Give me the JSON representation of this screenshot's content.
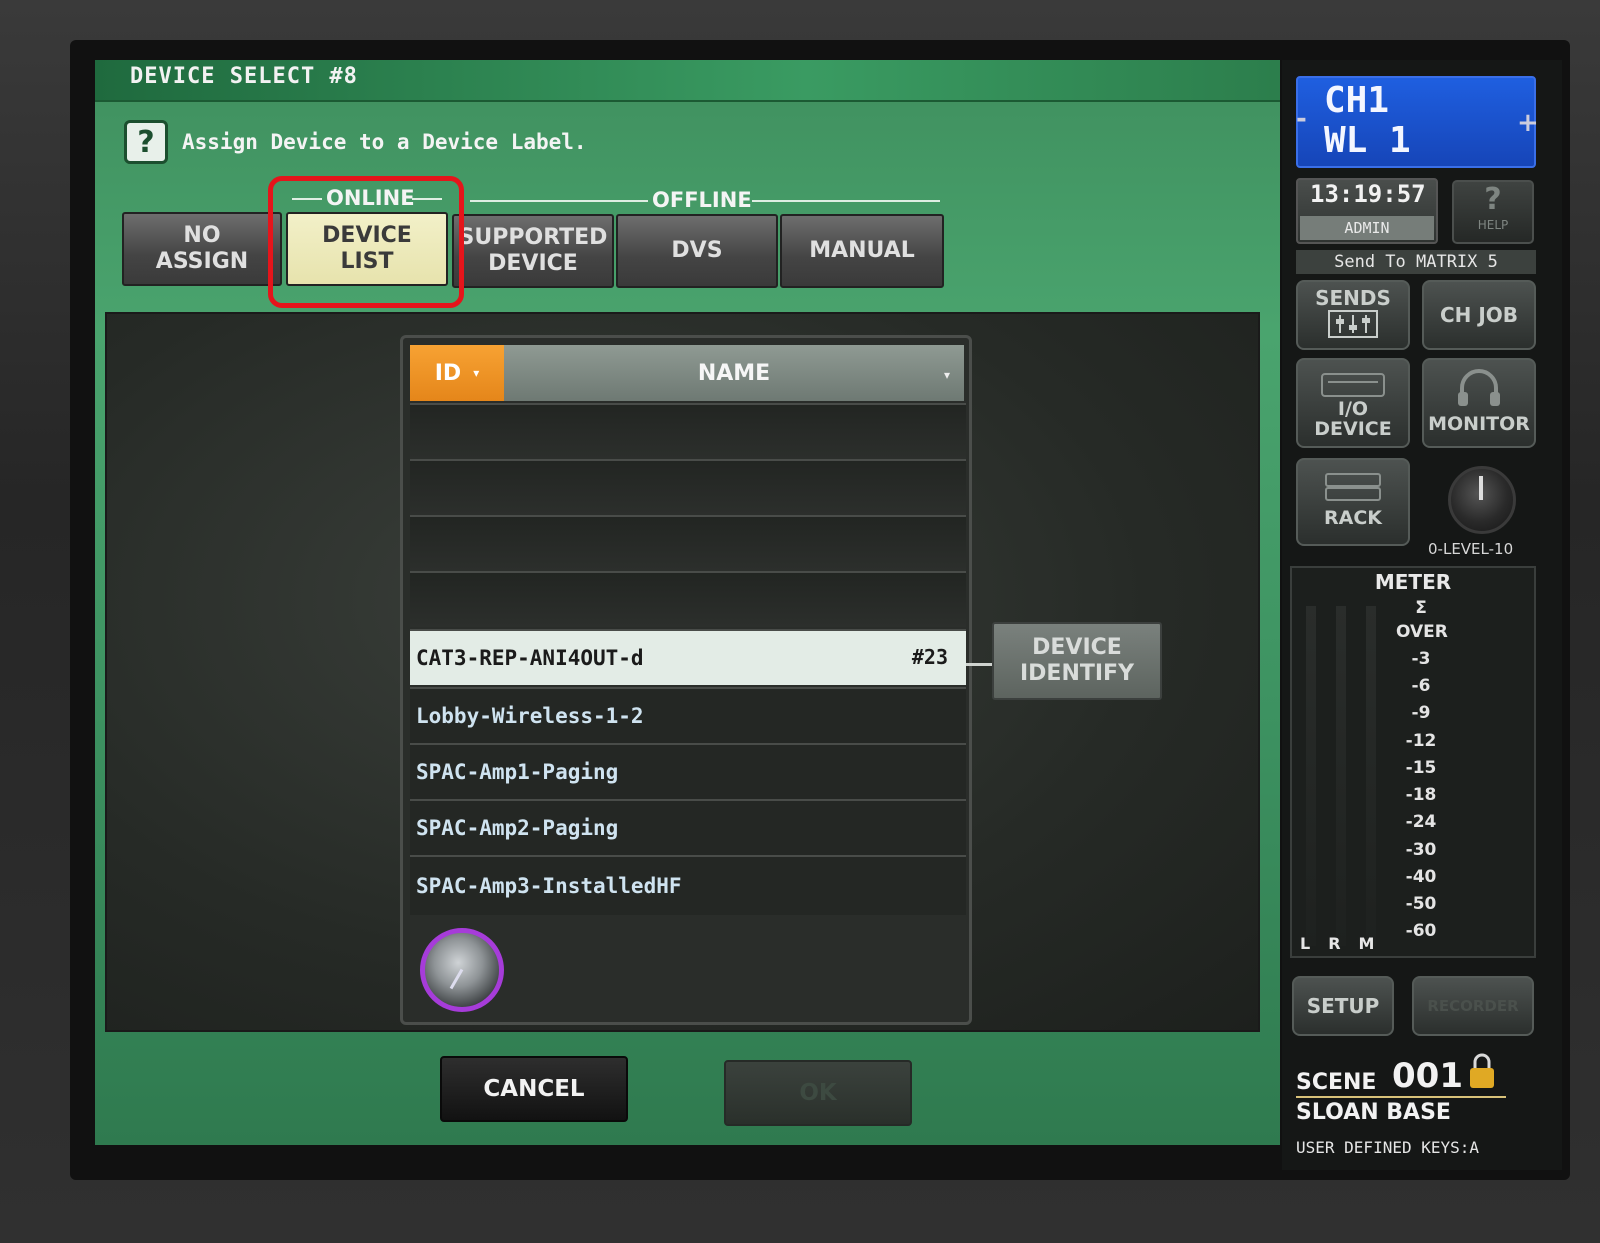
{
  "dialog": {
    "title": "DEVICE SELECT #8",
    "instruction": "Assign Device to a Device Label.",
    "help_glyph": "?",
    "groups": {
      "online": "ONLINE",
      "offline": "OFFLINE"
    },
    "tabs": [
      {
        "label": "NO\nASSIGN",
        "active": false
      },
      {
        "label": "DEVICE\nLIST",
        "active": true
      },
      {
        "label": "SUPPORTED\nDEVICE",
        "active": false
      },
      {
        "label": "DVS",
        "active": false
      },
      {
        "label": "MANUAL",
        "active": false
      }
    ],
    "list": {
      "col_id": "ID",
      "col_name": "NAME",
      "sort_arrow": "▾",
      "rows": [
        {
          "name": "CAT3-REP-ANI4OUT-d",
          "id": "#23"
        },
        {
          "name": "Lobby-Wireless-1-2",
          "id": ""
        },
        {
          "name": "SPAC-Amp1-Paging",
          "id": ""
        },
        {
          "name": "SPAC-Amp2-Paging",
          "id": ""
        },
        {
          "name": "SPAC-Amp3-InstalledHF",
          "id": ""
        }
      ]
    },
    "identify_button": "DEVICE\nIDENTIFY",
    "cancel_button": "CANCEL",
    "ok_button": "OK"
  },
  "sidebar": {
    "channel_line1": "CH1",
    "channel_line2": "WL 1",
    "minus": "-",
    "plus": "+",
    "time": "13:19:57",
    "user": "ADMIN",
    "help_glyph": "?",
    "help_label": "HELP",
    "send_to": "Send To MATRIX 5",
    "sends_label": "SENDS",
    "ch_job_label": "CH JOB",
    "io_device_label": "I/O\nDEVICE",
    "monitor_label": "MONITOR",
    "rack_label": "RACK",
    "level_label": "0-LEVEL-10",
    "meter_title": "METER",
    "meter_scale": [
      "Σ",
      "OVER",
      "-3",
      "-6",
      "-9",
      "-12",
      "-15",
      "-18",
      "-24",
      "-30",
      "-40",
      "-50",
      "-60"
    ],
    "meter_channels": "LRM",
    "setup_label": "SETUP",
    "recorder_label": "RECORDER",
    "scene_label": "SCENE",
    "scene_number": "001",
    "scene_name": "SLOAN BASE",
    "user_keys": "USER DEFINED KEYS:A"
  },
  "colors": {
    "accent_orange": "#f7a233",
    "highlight_red": "#e5151b",
    "channel_blue": "#1f5fe0",
    "dialog_green": "#3d9261"
  }
}
